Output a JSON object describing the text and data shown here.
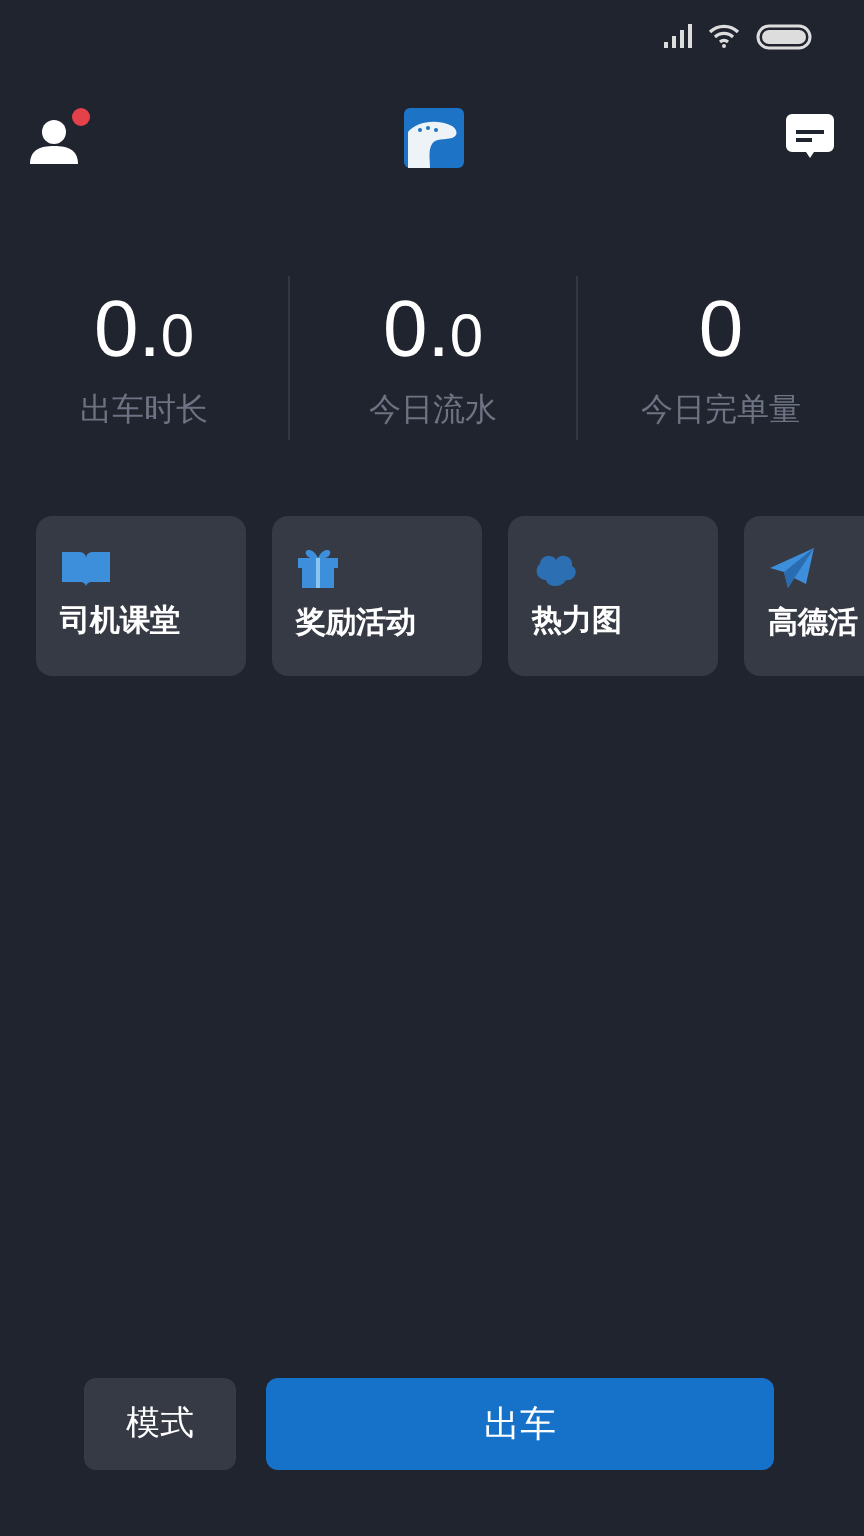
{
  "header": {
    "notification_dot": true
  },
  "stats": [
    {
      "value": "0.",
      "decimal": "0",
      "label": "出车时长"
    },
    {
      "value": "0.",
      "decimal": "0",
      "label": "今日流水"
    },
    {
      "value": "0",
      "label": "今日完单量"
    }
  ],
  "shortcuts": [
    {
      "kind": "book",
      "label": "司机课堂"
    },
    {
      "kind": "gift",
      "label": "奖励活动"
    },
    {
      "kind": "heat",
      "label": "热力图"
    },
    {
      "kind": "plane",
      "label": "高德活"
    }
  ],
  "bottom": {
    "mode_button": "模式",
    "start_button": "出车"
  }
}
